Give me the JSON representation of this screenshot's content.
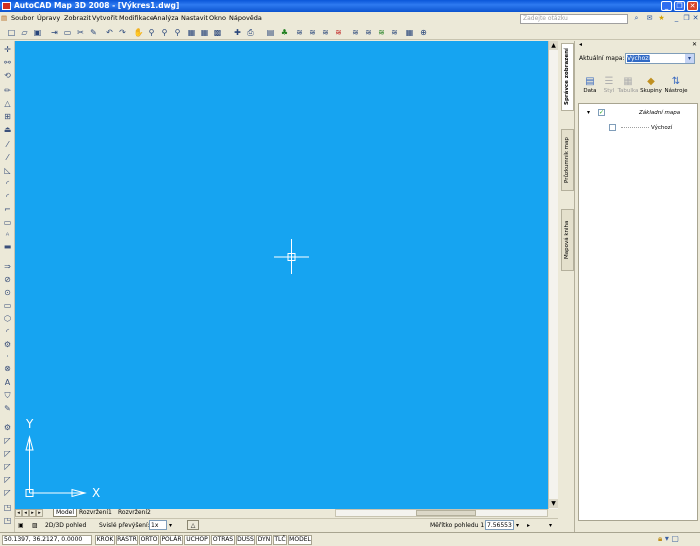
{
  "window": {
    "title": "AutoCAD Map 3D 2008 - [Výkres1.dwg]",
    "minimize_icon": "minimize-icon",
    "restore_icon": "restore-icon",
    "close_icon": "close-icon"
  },
  "menu": [
    "Soubor",
    "Úpravy",
    "Zobrazit",
    "Vytvořit",
    "Modifikace",
    "Analýza",
    "Nastavit",
    "Okno",
    "Nápověda"
  ],
  "help": {
    "placeholder": "Zadejte otázku"
  },
  "layout_tabs": [
    "Model",
    "Rozvržení1",
    "Rozvržení2"
  ],
  "viewbar": {
    "view_label": "2D/3D pohled",
    "vertical_exag_label": "Svislé převýšení:",
    "vertical_exag_value": "1x",
    "scale_label": "Měřítko pohledu 1 :",
    "scale_value": "7.56553"
  },
  "statusbar": {
    "coords": "50.1397, 36.2127, 0.0000",
    "toggles": [
      "KROK",
      "RASTR",
      "ORTO",
      "POLÁR",
      "UCHOP",
      "OTRAS",
      "DUSS",
      "DYN",
      "TLČ",
      "MODEL"
    ]
  },
  "canvas": {
    "background": "#16a4f1",
    "ucs_x": "X",
    "ucs_y": "Y"
  },
  "palette": {
    "tabs": [
      "Správce zobrazení",
      "Průzkumník map",
      "Mapová kniha"
    ],
    "current_map_label": "Aktuální mapa:",
    "current_map_value": "Výchozí",
    "tools": [
      {
        "label": "Data",
        "icon": "data-icon"
      },
      {
        "label": "Styl",
        "icon": "style-icon"
      },
      {
        "label": "Tabulka",
        "icon": "table-icon"
      },
      {
        "label": "Skupiny",
        "icon": "groups-icon"
      },
      {
        "label": "Nástroje",
        "icon": "tools-icon"
      }
    ],
    "tree": [
      {
        "label": "Základní mapa",
        "checked": true
      },
      {
        "label": "Výchozí",
        "checked": false
      }
    ]
  }
}
